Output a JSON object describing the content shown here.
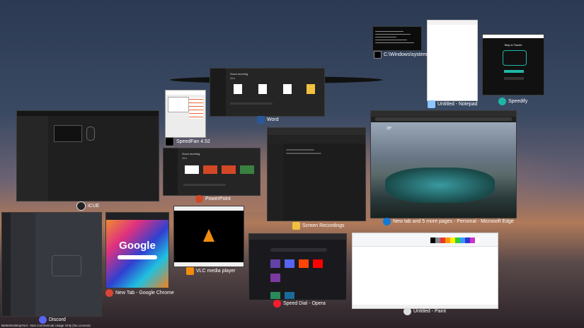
{
  "desktop": {
    "watermark": "BetterDesktopTool - Non Commercial Usage Only (No License)"
  },
  "windows": {
    "cmd": {
      "label": "C:\\Windows\\system"
    },
    "notepad": {
      "label": "Untitled - Notepad"
    },
    "speedify": {
      "label": "Speedify",
      "inner_text": "Stay in Touch!"
    },
    "word": {
      "label": "Word",
      "home_title": "Good morning",
      "section": "New"
    },
    "speedfan": {
      "label": "SpeedFan 4.52"
    },
    "icue": {
      "label": "iCUE"
    },
    "powerpoint": {
      "label": "PowerPoint",
      "home_title": "Good morning",
      "section": "New"
    },
    "explorer": {
      "label": "Screen Recordings"
    },
    "edge": {
      "label": "New tab and 5 more pages - Personal - Microsoft Edge",
      "temp": "28°"
    },
    "discord": {
      "label": "Discord"
    },
    "chrome": {
      "label": "New Tab - Google Chrome",
      "logo_text": "Google"
    },
    "vlc": {
      "label": "VLC media player"
    },
    "opera": {
      "label": "Speed Dial - Opera"
    },
    "paint": {
      "label": "Untitled - Paint"
    }
  },
  "colors": {
    "word_blue": "#2b579a",
    "ppt_orange": "#d24726",
    "edge_blue": "#0f7ad7",
    "speedify_teal": "#1fb6a6",
    "opera_red": "#ff1b2d",
    "discord_blurple": "#5865f2",
    "vlc_orange": "#f28c0f",
    "chrome_red": "#db4437"
  }
}
